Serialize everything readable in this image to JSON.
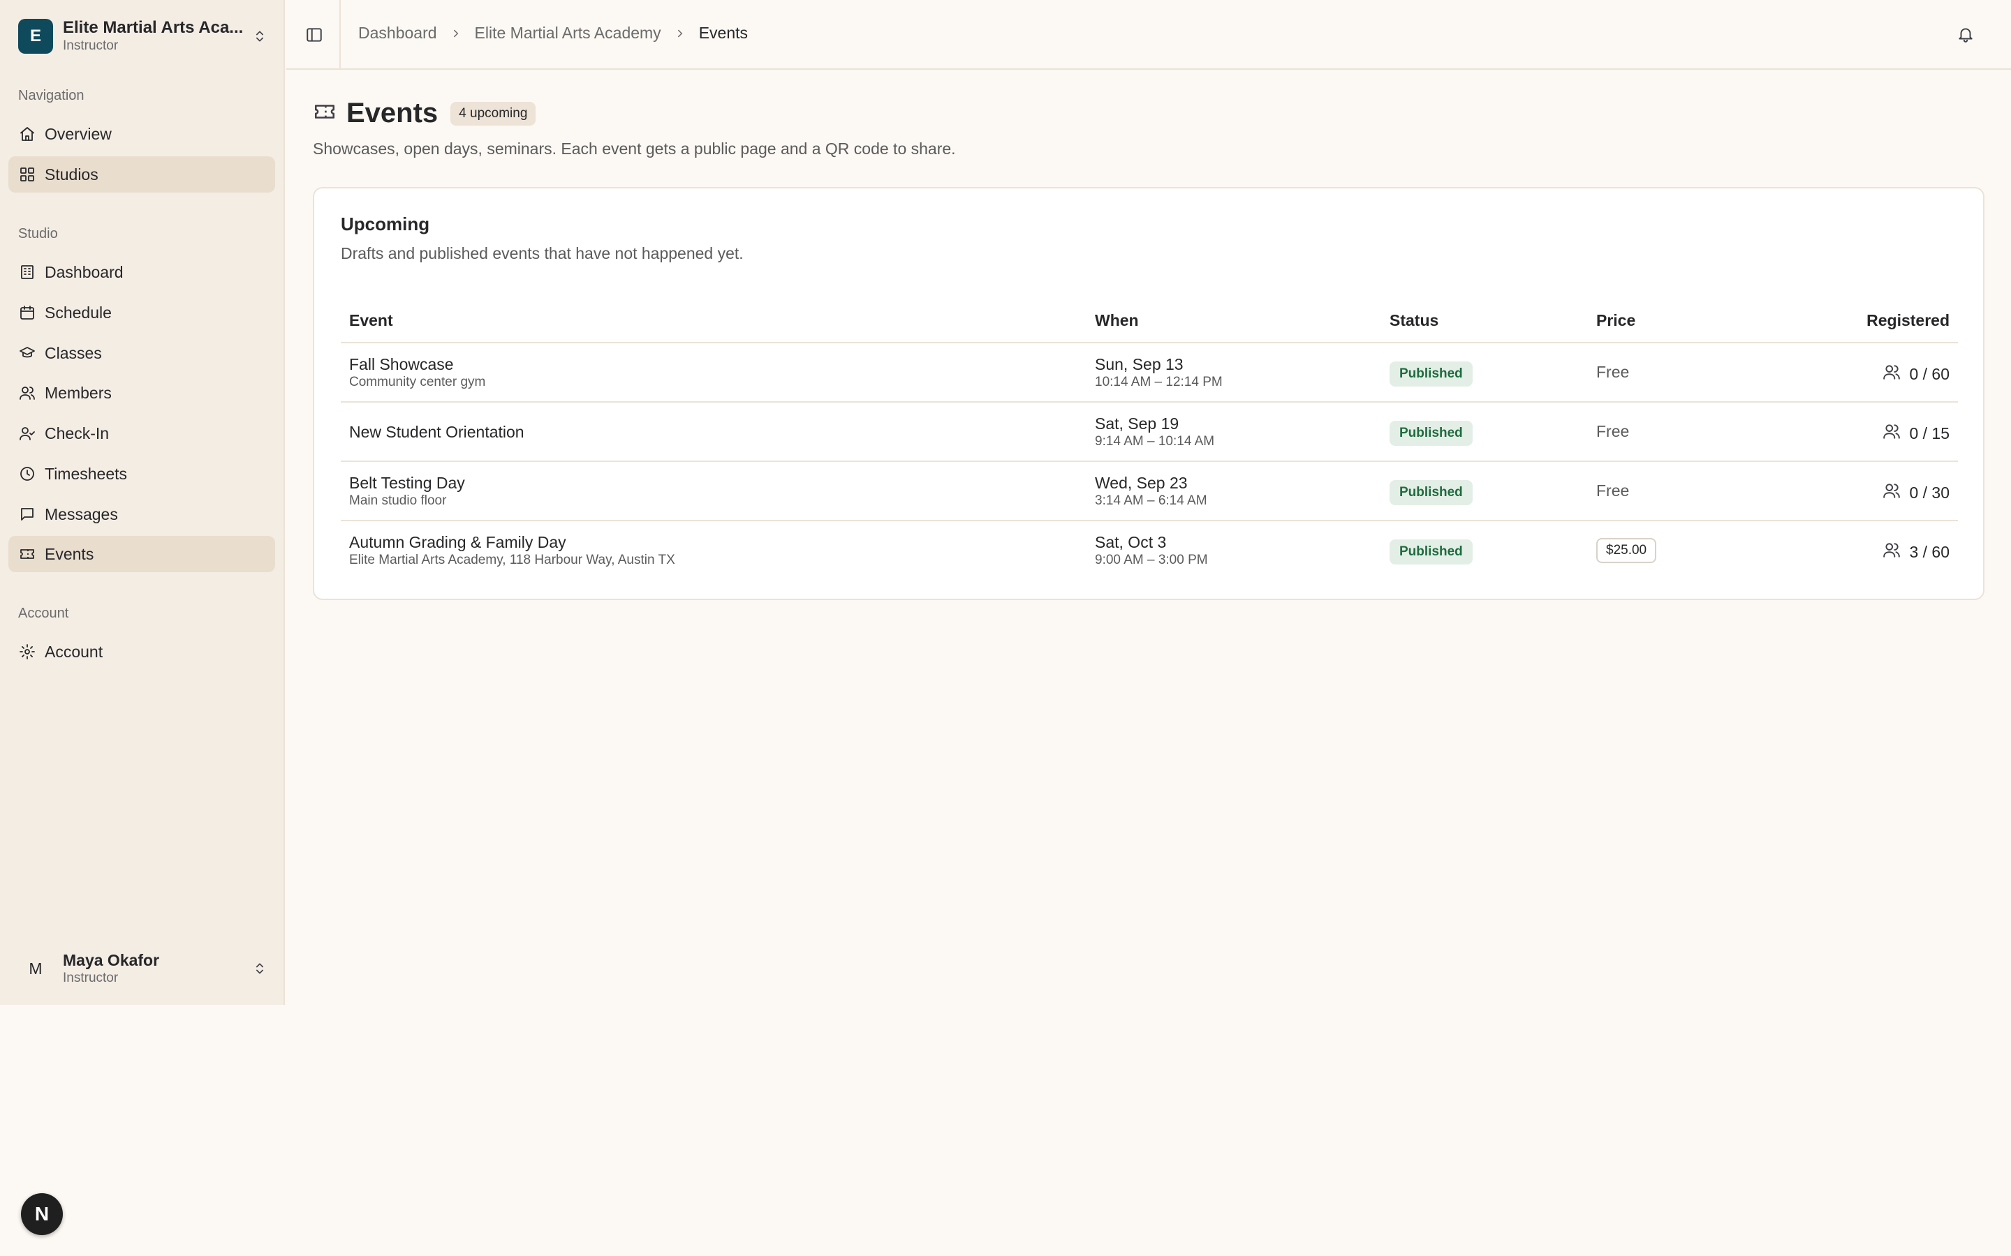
{
  "workspace": {
    "name": "Elite Martial Arts Aca...",
    "role": "Instructor",
    "initial": "E"
  },
  "nav": {
    "navigation_label": "Navigation",
    "navigation": [
      {
        "label": "Overview"
      },
      {
        "label": "Studios"
      }
    ],
    "studio_label": "Studio",
    "studio": [
      {
        "label": "Dashboard"
      },
      {
        "label": "Schedule"
      },
      {
        "label": "Classes"
      },
      {
        "label": "Members"
      },
      {
        "label": "Check-In"
      },
      {
        "label": "Timesheets"
      },
      {
        "label": "Messages"
      },
      {
        "label": "Events"
      }
    ],
    "account_label": "Account",
    "account": [
      {
        "label": "Account"
      }
    ]
  },
  "user": {
    "name": "Maya Okafor",
    "role": "Instructor",
    "initial": "M"
  },
  "breadcrumb": [
    "Dashboard",
    "Elite Martial Arts Academy",
    "Events"
  ],
  "page": {
    "title": "Events",
    "badge": "4 upcoming",
    "subtitle": "Showcases, open days, seminars. Each event gets a public page and a QR code to share."
  },
  "card": {
    "title": "Upcoming",
    "description": "Drafts and published events that have not happened yet.",
    "columns": {
      "event": "Event",
      "when": "When",
      "status": "Status",
      "price": "Price",
      "registered": "Registered"
    },
    "rows": [
      {
        "name": "Fall Showcase",
        "location": "Community center gym",
        "date": "Sun, Sep 13",
        "time": "10:14 AM – 12:14 PM",
        "status": "Published",
        "price": "Free",
        "registered": "0 / 60"
      },
      {
        "name": "New Student Orientation",
        "location": "",
        "date": "Sat, Sep 19",
        "time": "9:14 AM – 10:14 AM",
        "status": "Published",
        "price": "Free",
        "registered": "0 / 15"
      },
      {
        "name": "Belt Testing Day",
        "location": "Main studio floor",
        "date": "Wed, Sep 23",
        "time": "3:14 AM – 6:14 AM",
        "status": "Published",
        "price": "Free",
        "registered": "0 / 30"
      },
      {
        "name": "Autumn Grading & Family Day",
        "location": "Elite Martial Arts Academy, 118 Harbour Way, Austin TX",
        "date": "Sat, Oct 3",
        "time": "9:00 AM – 3:00 PM",
        "status": "Published",
        "price": "$25.00",
        "registered": "3 / 60"
      }
    ]
  },
  "fab": {
    "label": "N"
  },
  "colors": {
    "brand": "#0f4a5c",
    "published_bg": "#e3efe6",
    "published_text": "#1f6b3f",
    "active_nav": "#e9ddce",
    "background": "#fcf8f3"
  }
}
